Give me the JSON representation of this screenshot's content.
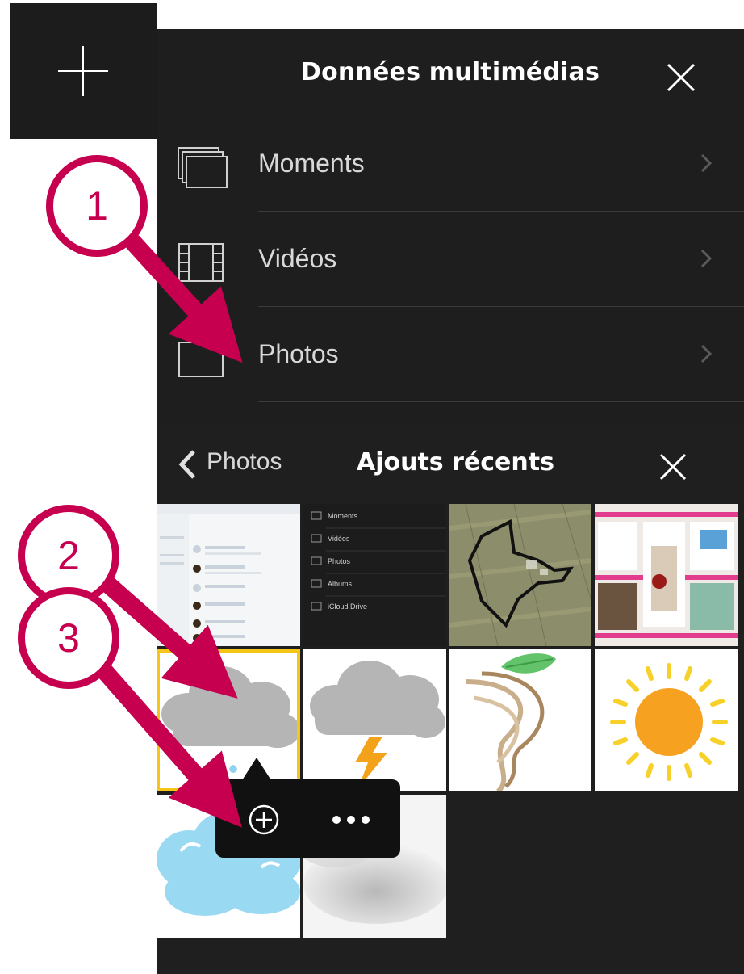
{
  "media_panel": {
    "title": "Données multimédias",
    "items": [
      {
        "label": "Moments",
        "icon": "moments-icon"
      },
      {
        "label": "Vidéos",
        "icon": "film-icon"
      },
      {
        "label": "Photos",
        "icon": "photo-frame-icon"
      }
    ]
  },
  "recents_panel": {
    "back_label": "Photos",
    "title": "Ajouts récents"
  },
  "thumb_menu": {
    "items": [
      "Moments",
      "Vidéos",
      "Photos",
      "Albums",
      "iCloud Drive"
    ]
  },
  "annotations": [
    "1",
    "2",
    "3"
  ],
  "colors": {
    "annotation": "#c6004f",
    "selection": "#f5c518",
    "panel_bg": "#1e1e1e"
  }
}
